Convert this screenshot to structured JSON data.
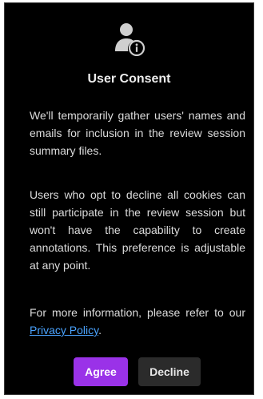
{
  "dialog": {
    "icon": "user-info-icon",
    "title": "User Consent",
    "paragraph1": "We'll temporarily gather users' names and emails for inclusion in the review session summary files.",
    "paragraph2": "Users who opt to decline all cookies can still participate in the review session but won't have the capability to create annotations. This preference is adjustable at any point.",
    "paragraph3_prefix": "For more information, please refer to our ",
    "privacy_link": "Privacy Policy",
    "paragraph3_suffix": ".",
    "agree_label": "Agree",
    "decline_label": "Decline"
  },
  "colors": {
    "background": "#000000",
    "text": "#dcdcdc",
    "link": "#4aa3ff",
    "agree_button": "#9a32e8",
    "decline_button": "#2b2b2b"
  }
}
